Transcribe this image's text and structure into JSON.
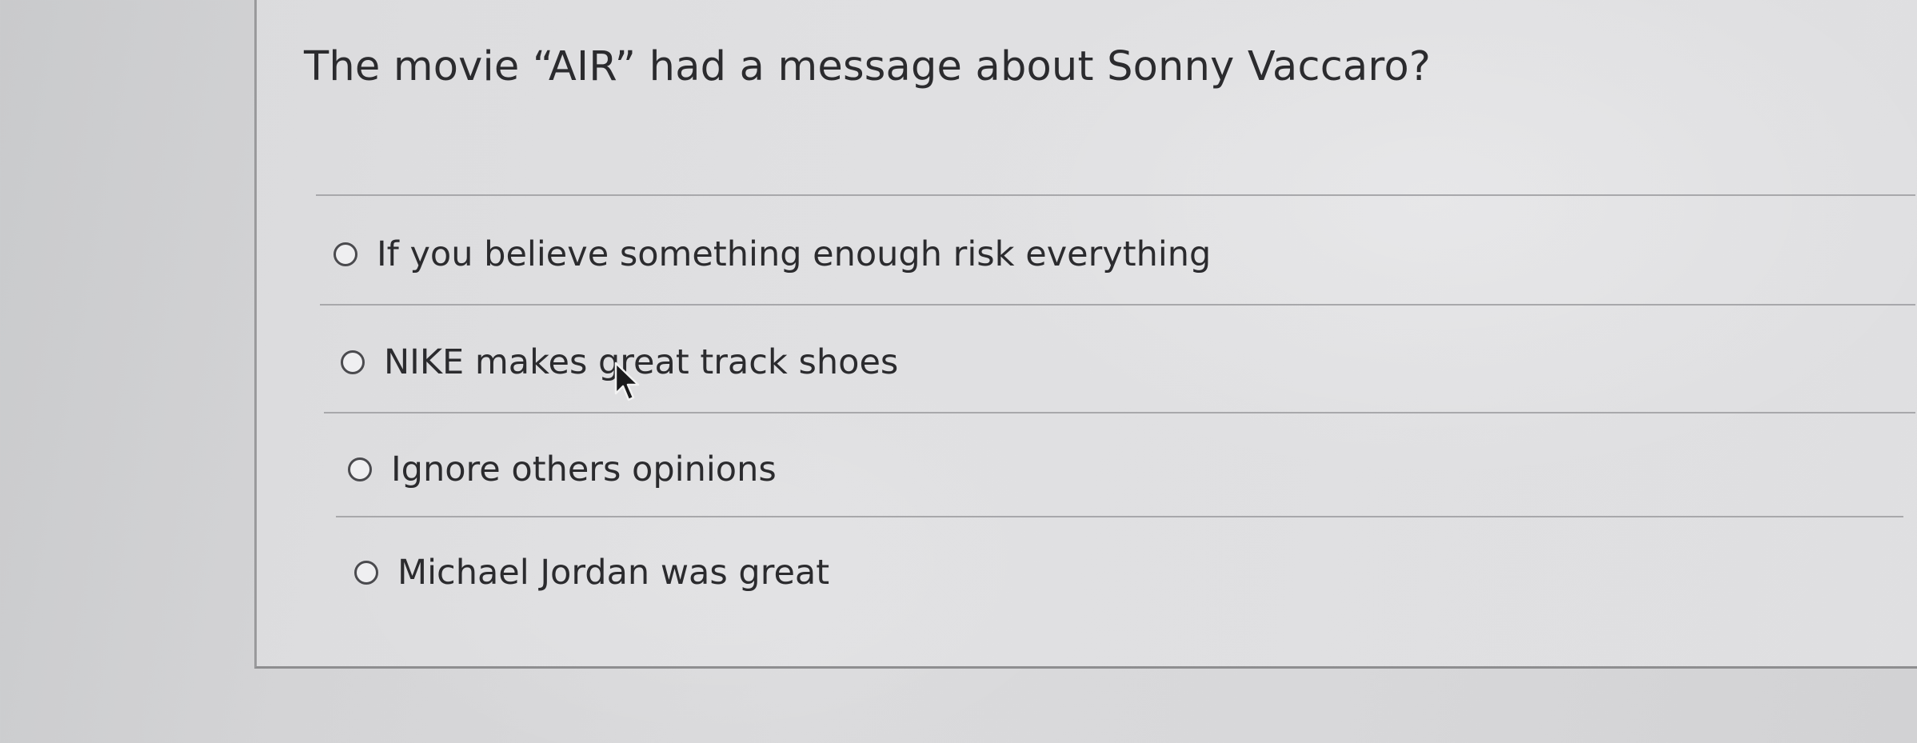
{
  "question": {
    "title": "The movie “AIR” had a message about Sonny Vaccaro?"
  },
  "options": [
    {
      "label": "If you believe something enough risk everything",
      "selected": false
    },
    {
      "label": "NIKE makes great track shoes",
      "selected": false
    },
    {
      "label": "Ignore others opinions",
      "selected": false
    },
    {
      "label": "Michael Jordan was great",
      "selected": false
    }
  ],
  "icons": {
    "cursor": "mouse-pointer-arrow-icon",
    "radio": "radio-button-unchecked-icon"
  }
}
